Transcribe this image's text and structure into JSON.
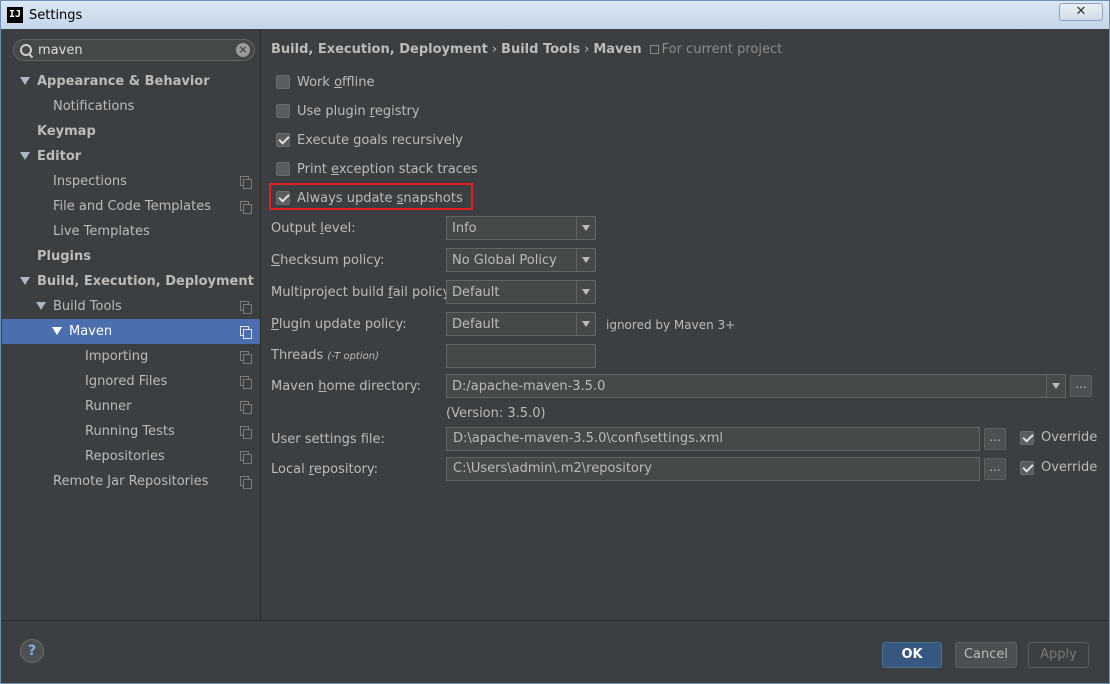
{
  "window": {
    "title": "Settings",
    "app_icon": "IJ"
  },
  "search": {
    "value": "maven",
    "placeholder": ""
  },
  "tree": [
    {
      "label": "Appearance & Behavior",
      "level": 0,
      "bold": true,
      "expanded": true,
      "scope_icon": false
    },
    {
      "label": "Notifications",
      "level": 1,
      "bold": false,
      "expanded": null,
      "scope_icon": false
    },
    {
      "label": "Keymap",
      "level": 0,
      "bold": true,
      "expanded": null,
      "scope_icon": false
    },
    {
      "label": "Editor",
      "level": 0,
      "bold": true,
      "expanded": true,
      "scope_icon": false
    },
    {
      "label": "Inspections",
      "level": 1,
      "bold": false,
      "expanded": null,
      "scope_icon": true
    },
    {
      "label": "File and Code Templates",
      "level": 1,
      "bold": false,
      "expanded": null,
      "scope_icon": true
    },
    {
      "label": "Live Templates",
      "level": 1,
      "bold": false,
      "expanded": null,
      "scope_icon": false
    },
    {
      "label": "Plugins",
      "level": 0,
      "bold": true,
      "expanded": null,
      "scope_icon": false
    },
    {
      "label": "Build, Execution, Deployment",
      "level": 0,
      "bold": true,
      "expanded": true,
      "scope_icon": false
    },
    {
      "label": "Build Tools",
      "level": 1,
      "bold": false,
      "expanded": true,
      "scope_icon": true
    },
    {
      "label": "Maven",
      "level": 2,
      "bold": false,
      "expanded": true,
      "scope_icon": true,
      "selected": true
    },
    {
      "label": "Importing",
      "level": 3,
      "bold": false,
      "expanded": null,
      "scope_icon": true
    },
    {
      "label": "Ignored Files",
      "level": 3,
      "bold": false,
      "expanded": null,
      "scope_icon": true
    },
    {
      "label": "Runner",
      "level": 3,
      "bold": false,
      "expanded": null,
      "scope_icon": true
    },
    {
      "label": "Running Tests",
      "level": 3,
      "bold": false,
      "expanded": null,
      "scope_icon": true
    },
    {
      "label": "Repositories",
      "level": 3,
      "bold": false,
      "expanded": null,
      "scope_icon": true
    },
    {
      "label": "Remote Jar Repositories",
      "level": 1,
      "bold": false,
      "expanded": null,
      "scope_icon": true
    }
  ],
  "breadcrumb": {
    "part1": "Build, Execution, Deployment",
    "part2": "Build Tools",
    "part3": "Maven",
    "separator": "›",
    "scope": "For current project"
  },
  "checkboxes": {
    "work_offline": {
      "label_pre": "Work ",
      "label_u": "o",
      "label_post": "ffline",
      "checked": false
    },
    "plugin_registry": {
      "label_pre": "Use plugin ",
      "label_u": "r",
      "label_post": "egistry",
      "checked": false
    },
    "execute_goals": {
      "label_pre": "Execute ",
      "label_u": "g",
      "label_post": "oals recursively",
      "checked": true
    },
    "print_exception": {
      "label_pre": "Print ",
      "label_u": "e",
      "label_post": "xception stack traces",
      "checked": false
    },
    "always_update": {
      "label_pre": "Always update ",
      "label_u": "s",
      "label_post": "napshots",
      "checked": true
    }
  },
  "form": {
    "output_level": {
      "label_pre": "Output ",
      "label_u": "l",
      "label_post": "evel:",
      "value": "Info"
    },
    "checksum_policy": {
      "label_pre": "",
      "label_u": "C",
      "label_post": "hecksum policy:",
      "value": "No Global Policy"
    },
    "multiproject_policy": {
      "label_pre": "Multiproject build ",
      "label_u": "f",
      "label_post": "ail policy:",
      "value": "Default"
    },
    "plugin_update_policy": {
      "label_pre": "",
      "label_u": "P",
      "label_post": "lugin update policy:",
      "value": "Default",
      "hint": "ignored by Maven 3+"
    },
    "threads": {
      "label": "Threads ",
      "label_small": "(-T option)",
      "value": ""
    },
    "maven_home": {
      "label_pre": "Maven ",
      "label_u": "h",
      "label_post": "ome directory:",
      "value": "D:/apache-maven-3.5.0",
      "version": "(Version: 3.5.0)"
    },
    "user_settings": {
      "label": "User settings file:",
      "value": "D:\\apache-maven-3.5.0\\conf\\settings.xml",
      "override_label": "Override",
      "override_checked": true
    },
    "local_repo": {
      "label_pre": "Local ",
      "label_u": "r",
      "label_post": "epository:",
      "value": "C:\\Users\\admin\\.m2\\repository",
      "override_label": "Override",
      "override_checked": true
    },
    "browse_label": "..."
  },
  "buttons": {
    "ok": "OK",
    "cancel": "Cancel",
    "apply": "Apply",
    "help": "?"
  },
  "colors": {
    "background": "#3c3f41",
    "selection": "#4b6eaf",
    "highlight_border": "#e02020",
    "ok_button": "#365880"
  }
}
